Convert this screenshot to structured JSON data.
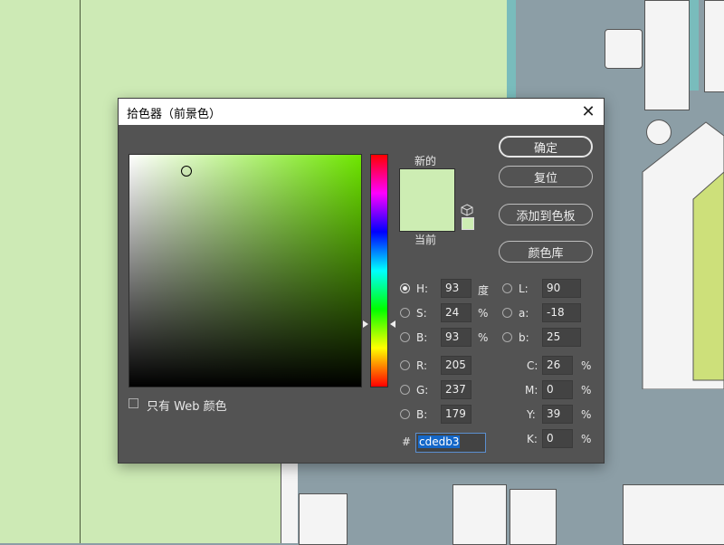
{
  "dialog": {
    "title": "拾色器（前景色）",
    "close_icon": "close-icon",
    "new_label": "新的",
    "current_label": "当前",
    "new_color": "#cdedb3",
    "current_color": "#cdedb3",
    "web_only_label": "只有 Web 颜色",
    "web_only_checked": false,
    "buttons": {
      "ok": "确定",
      "reset": "复位",
      "add_to_swatches": "添加到色板",
      "color_libraries": "颜色库"
    },
    "hsb": {
      "h_label": "H:",
      "h_value": "93",
      "h_unit": "度",
      "h_selected": true,
      "s_label": "S:",
      "s_value": "24",
      "s_unit": "%",
      "b_label": "B:",
      "b_value": "93",
      "b_unit": "%"
    },
    "lab": {
      "l_label": "L:",
      "l_value": "90",
      "a_label": "a:",
      "a_value": "-18",
      "b_label": "b:",
      "b_value": "25"
    },
    "rgb": {
      "r_label": "R:",
      "r_value": "205",
      "g_label": "G:",
      "g_value": "237",
      "b_label": "B:",
      "b_value": "179"
    },
    "cmyk": {
      "c_label": "C:",
      "c_value": "26",
      "c_unit": "%",
      "m_label": "M:",
      "m_value": "0",
      "m_unit": "%",
      "y_label": "Y:",
      "y_value": "39",
      "y_unit": "%",
      "k_label": "K:",
      "k_value": "0",
      "k_unit": "%"
    },
    "hex_label": "#",
    "hex_value": "cdedb3",
    "hue_gradient_top_color": "#ff0000",
    "field_hue_color": "#6ee600"
  }
}
